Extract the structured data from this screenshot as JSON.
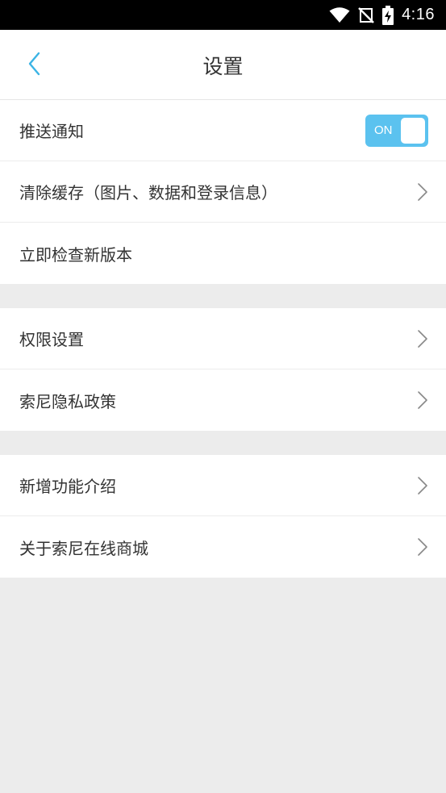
{
  "status_bar": {
    "time": "4:16",
    "icons": [
      "wifi-icon",
      "no-signal-icon",
      "battery-charging-icon"
    ]
  },
  "header": {
    "title": "设置",
    "back_icon": "chevron-left-icon"
  },
  "colors": {
    "accent": "#5bc2ef",
    "back_icon": "#3bb4e5",
    "background": "#ececec"
  },
  "groups": [
    {
      "items": [
        {
          "label": "推送通知",
          "control": "toggle",
          "toggle_text": "ON",
          "toggle_on": true
        },
        {
          "label": "清除缓存（图片、数据和登录信息）",
          "control": "chevron"
        },
        {
          "label": "立即检查新版本",
          "control": "none"
        }
      ]
    },
    {
      "items": [
        {
          "label": "权限设置",
          "control": "chevron"
        },
        {
          "label": "索尼隐私政策",
          "control": "chevron"
        }
      ]
    },
    {
      "items": [
        {
          "label": "新增功能介绍",
          "control": "chevron"
        },
        {
          "label": "关于索尼在线商城",
          "control": "chevron"
        }
      ]
    }
  ]
}
